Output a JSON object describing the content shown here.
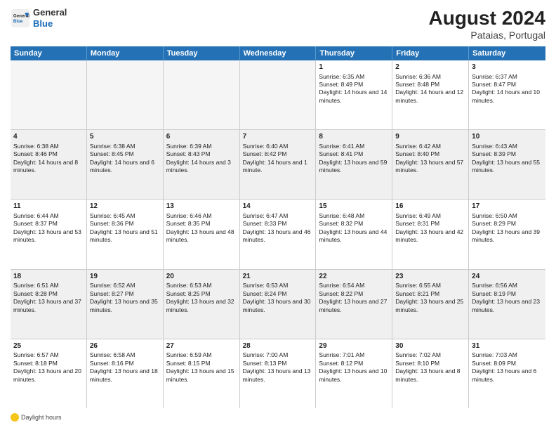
{
  "header": {
    "month_year": "August 2024",
    "location": "Pataias, Portugal",
    "logo_general": "General",
    "logo_blue": "Blue"
  },
  "days_of_week": [
    "Sunday",
    "Monday",
    "Tuesday",
    "Wednesday",
    "Thursday",
    "Friday",
    "Saturday"
  ],
  "weeks": [
    [
      {
        "day": "",
        "sunrise": "",
        "sunset": "",
        "daylight": "",
        "empty": true
      },
      {
        "day": "",
        "sunrise": "",
        "sunset": "",
        "daylight": "",
        "empty": true
      },
      {
        "day": "",
        "sunrise": "",
        "sunset": "",
        "daylight": "",
        "empty": true
      },
      {
        "day": "",
        "sunrise": "",
        "sunset": "",
        "daylight": "",
        "empty": true
      },
      {
        "day": "1",
        "sunrise": "Sunrise: 6:35 AM",
        "sunset": "Sunset: 8:49 PM",
        "daylight": "Daylight: 14 hours and 14 minutes.",
        "empty": false
      },
      {
        "day": "2",
        "sunrise": "Sunrise: 6:36 AM",
        "sunset": "Sunset: 8:48 PM",
        "daylight": "Daylight: 14 hours and 12 minutes.",
        "empty": false
      },
      {
        "day": "3",
        "sunrise": "Sunrise: 6:37 AM",
        "sunset": "Sunset: 8:47 PM",
        "daylight": "Daylight: 14 hours and 10 minutes.",
        "empty": false
      }
    ],
    [
      {
        "day": "4",
        "sunrise": "Sunrise: 6:38 AM",
        "sunset": "Sunset: 8:46 PM",
        "daylight": "Daylight: 14 hours and 8 minutes.",
        "empty": false
      },
      {
        "day": "5",
        "sunrise": "Sunrise: 6:38 AM",
        "sunset": "Sunset: 8:45 PM",
        "daylight": "Daylight: 14 hours and 6 minutes.",
        "empty": false
      },
      {
        "day": "6",
        "sunrise": "Sunrise: 6:39 AM",
        "sunset": "Sunset: 8:43 PM",
        "daylight": "Daylight: 14 hours and 3 minutes.",
        "empty": false
      },
      {
        "day": "7",
        "sunrise": "Sunrise: 6:40 AM",
        "sunset": "Sunset: 8:42 PM",
        "daylight": "Daylight: 14 hours and 1 minute.",
        "empty": false
      },
      {
        "day": "8",
        "sunrise": "Sunrise: 6:41 AM",
        "sunset": "Sunset: 8:41 PM",
        "daylight": "Daylight: 13 hours and 59 minutes.",
        "empty": false
      },
      {
        "day": "9",
        "sunrise": "Sunrise: 6:42 AM",
        "sunset": "Sunset: 8:40 PM",
        "daylight": "Daylight: 13 hours and 57 minutes.",
        "empty": false
      },
      {
        "day": "10",
        "sunrise": "Sunrise: 6:43 AM",
        "sunset": "Sunset: 8:39 PM",
        "daylight": "Daylight: 13 hours and 55 minutes.",
        "empty": false
      }
    ],
    [
      {
        "day": "11",
        "sunrise": "Sunrise: 6:44 AM",
        "sunset": "Sunset: 8:37 PM",
        "daylight": "Daylight: 13 hours and 53 minutes.",
        "empty": false
      },
      {
        "day": "12",
        "sunrise": "Sunrise: 6:45 AM",
        "sunset": "Sunset: 8:36 PM",
        "daylight": "Daylight: 13 hours and 51 minutes.",
        "empty": false
      },
      {
        "day": "13",
        "sunrise": "Sunrise: 6:46 AM",
        "sunset": "Sunset: 8:35 PM",
        "daylight": "Daylight: 13 hours and 48 minutes.",
        "empty": false
      },
      {
        "day": "14",
        "sunrise": "Sunrise: 6:47 AM",
        "sunset": "Sunset: 8:33 PM",
        "daylight": "Daylight: 13 hours and 46 minutes.",
        "empty": false
      },
      {
        "day": "15",
        "sunrise": "Sunrise: 6:48 AM",
        "sunset": "Sunset: 8:32 PM",
        "daylight": "Daylight: 13 hours and 44 minutes.",
        "empty": false
      },
      {
        "day": "16",
        "sunrise": "Sunrise: 6:49 AM",
        "sunset": "Sunset: 8:31 PM",
        "daylight": "Daylight: 13 hours and 42 minutes.",
        "empty": false
      },
      {
        "day": "17",
        "sunrise": "Sunrise: 6:50 AM",
        "sunset": "Sunset: 8:29 PM",
        "daylight": "Daylight: 13 hours and 39 minutes.",
        "empty": false
      }
    ],
    [
      {
        "day": "18",
        "sunrise": "Sunrise: 6:51 AM",
        "sunset": "Sunset: 8:28 PM",
        "daylight": "Daylight: 13 hours and 37 minutes.",
        "empty": false
      },
      {
        "day": "19",
        "sunrise": "Sunrise: 6:52 AM",
        "sunset": "Sunset: 8:27 PM",
        "daylight": "Daylight: 13 hours and 35 minutes.",
        "empty": false
      },
      {
        "day": "20",
        "sunrise": "Sunrise: 6:53 AM",
        "sunset": "Sunset: 8:25 PM",
        "daylight": "Daylight: 13 hours and 32 minutes.",
        "empty": false
      },
      {
        "day": "21",
        "sunrise": "Sunrise: 6:53 AM",
        "sunset": "Sunset: 8:24 PM",
        "daylight": "Daylight: 13 hours and 30 minutes.",
        "empty": false
      },
      {
        "day": "22",
        "sunrise": "Sunrise: 6:54 AM",
        "sunset": "Sunset: 8:22 PM",
        "daylight": "Daylight: 13 hours and 27 minutes.",
        "empty": false
      },
      {
        "day": "23",
        "sunrise": "Sunrise: 6:55 AM",
        "sunset": "Sunset: 8:21 PM",
        "daylight": "Daylight: 13 hours and 25 minutes.",
        "empty": false
      },
      {
        "day": "24",
        "sunrise": "Sunrise: 6:56 AM",
        "sunset": "Sunset: 8:19 PM",
        "daylight": "Daylight: 13 hours and 23 minutes.",
        "empty": false
      }
    ],
    [
      {
        "day": "25",
        "sunrise": "Sunrise: 6:57 AM",
        "sunset": "Sunset: 8:18 PM",
        "daylight": "Daylight: 13 hours and 20 minutes.",
        "empty": false
      },
      {
        "day": "26",
        "sunrise": "Sunrise: 6:58 AM",
        "sunset": "Sunset: 8:16 PM",
        "daylight": "Daylight: 13 hours and 18 minutes.",
        "empty": false
      },
      {
        "day": "27",
        "sunrise": "Sunrise: 6:59 AM",
        "sunset": "Sunset: 8:15 PM",
        "daylight": "Daylight: 13 hours and 15 minutes.",
        "empty": false
      },
      {
        "day": "28",
        "sunrise": "Sunrise: 7:00 AM",
        "sunset": "Sunset: 8:13 PM",
        "daylight": "Daylight: 13 hours and 13 minutes.",
        "empty": false
      },
      {
        "day": "29",
        "sunrise": "Sunrise: 7:01 AM",
        "sunset": "Sunset: 8:12 PM",
        "daylight": "Daylight: 13 hours and 10 minutes.",
        "empty": false
      },
      {
        "day": "30",
        "sunrise": "Sunrise: 7:02 AM",
        "sunset": "Sunset: 8:10 PM",
        "daylight": "Daylight: 13 hours and 8 minutes.",
        "empty": false
      },
      {
        "day": "31",
        "sunrise": "Sunrise: 7:03 AM",
        "sunset": "Sunset: 8:09 PM",
        "daylight": "Daylight: 13 hours and 6 minutes.",
        "empty": false
      }
    ]
  ],
  "legend": {
    "daylight_label": "Daylight hours"
  }
}
